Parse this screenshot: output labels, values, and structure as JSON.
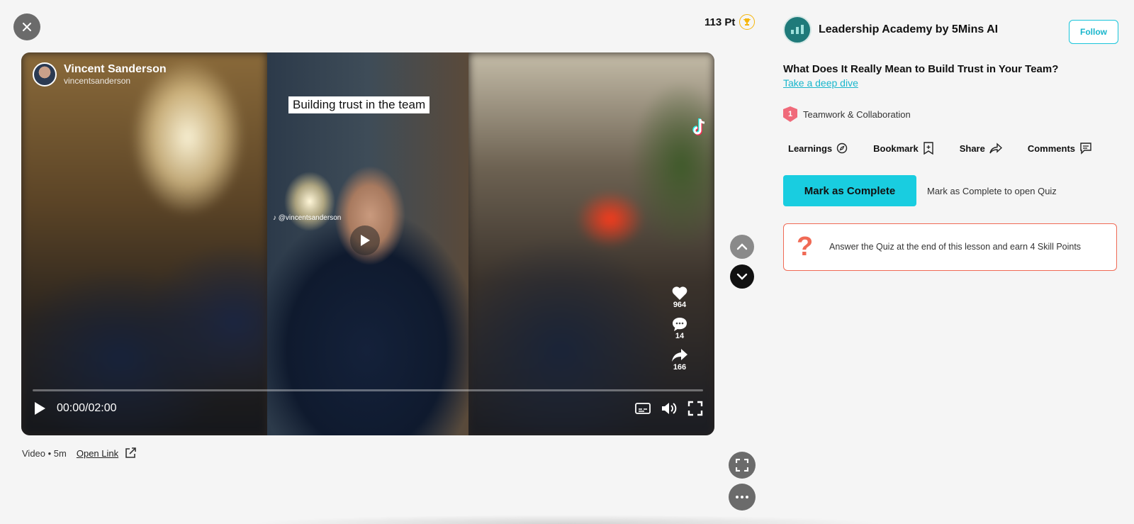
{
  "points": {
    "label": "113 Pt"
  },
  "video": {
    "channel_name": "Vincent Sanderson",
    "channel_handle": "vincentsanderson",
    "caption": "Building trust in the team",
    "watermark_handle": "@vincentsanderson",
    "likes": "964",
    "comments": "14",
    "shares": "166",
    "time": "00:00/02:00",
    "progress": 0
  },
  "meta": {
    "info": "Video • 5m",
    "open_link": "Open Link"
  },
  "right": {
    "brand_name": "Leadership Academy by 5Mins AI",
    "follow": "Follow",
    "lesson_title": "What Does It Really Mean to Build Trust in Your Team?",
    "deep_dive": "Take a deep dive",
    "topic_level": "1",
    "topic": "Teamwork & Collaboration",
    "actions": {
      "learnings": "Learnings",
      "bookmark": "Bookmark",
      "share": "Share",
      "comments": "Comments"
    },
    "complete_button": "Mark as Complete",
    "complete_hint": "Mark as Complete to open Quiz",
    "quiz_text": "Answer the Quiz at the end of this lesson and earn 4 Skill Points"
  },
  "colors": {
    "accent": "#19cde0",
    "quiz_border": "#f06a55",
    "trophy": "#f5b50a"
  }
}
